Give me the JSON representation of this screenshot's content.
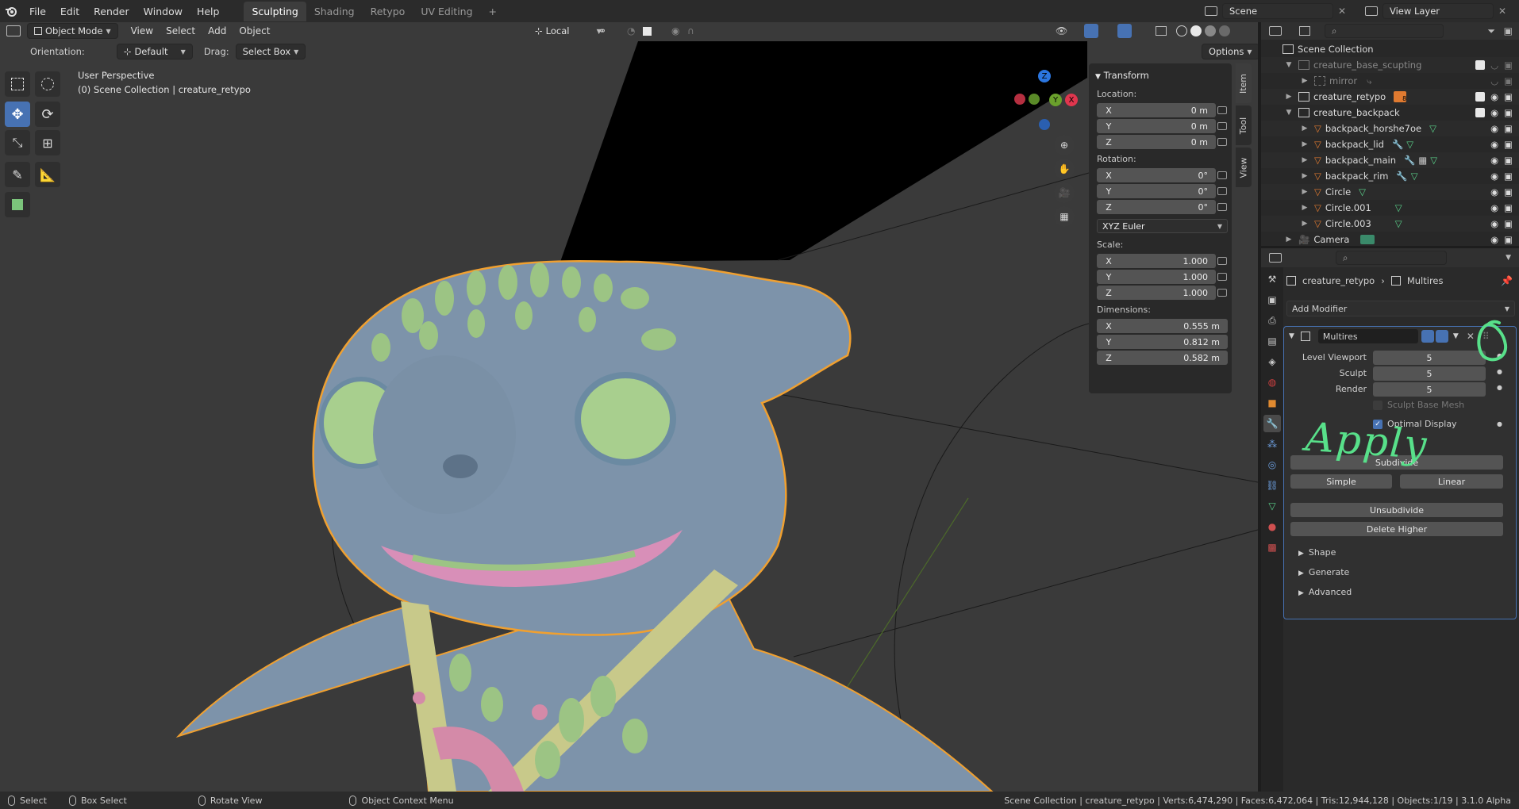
{
  "topbar": {
    "menus": [
      "File",
      "Edit",
      "Render",
      "Window",
      "Help"
    ],
    "workspaces": [
      "Sculpting",
      "Shading",
      "Retypo",
      "UV Editing"
    ],
    "active_workspace": "Sculpting",
    "add_tab": "+",
    "scene": "Scene",
    "view_layer": "View Layer"
  },
  "viewport": {
    "mode": "Object Mode",
    "menus": [
      "View",
      "Select",
      "Add",
      "Object"
    ],
    "transform_orientation": "Local",
    "orientation_label": "Orientation:",
    "orientation_value": "Default",
    "drag_label": "Drag:",
    "drag_value": "Select Box",
    "options": "Options",
    "perspective": "User Perspective",
    "collection_info": "(0) Scene Collection | creature_retypo",
    "gizmo": {
      "x": "X",
      "y": "Y",
      "z": "Z"
    }
  },
  "npanel": {
    "tabs": [
      "Item",
      "Tool",
      "View"
    ],
    "title": "Transform",
    "location_label": "Location:",
    "location": [
      {
        "axis": "X",
        "value": "0 m"
      },
      {
        "axis": "Y",
        "value": "0 m"
      },
      {
        "axis": "Z",
        "value": "0 m"
      }
    ],
    "rotation_label": "Rotation:",
    "rotation": [
      {
        "axis": "X",
        "value": "0°"
      },
      {
        "axis": "Y",
        "value": "0°"
      },
      {
        "axis": "Z",
        "value": "0°"
      }
    ],
    "rotation_mode": "XYZ Euler",
    "scale_label": "Scale:",
    "scale": [
      {
        "axis": "X",
        "value": "1.000"
      },
      {
        "axis": "Y",
        "value": "1.000"
      },
      {
        "axis": "Z",
        "value": "1.000"
      }
    ],
    "dimensions_label": "Dimensions:",
    "dimensions": [
      {
        "axis": "X",
        "value": "0.555 m"
      },
      {
        "axis": "Y",
        "value": "0.812 m"
      },
      {
        "axis": "Z",
        "value": "0.582 m"
      }
    ]
  },
  "outliner": {
    "rows": [
      {
        "name": "Scene Collection"
      },
      {
        "name": "creature_base_scupting"
      },
      {
        "name": "mirror"
      },
      {
        "name": "creature_retypo",
        "badge": "8"
      },
      {
        "name": "creature_backpack"
      },
      {
        "name": "backpack_horshe7oe"
      },
      {
        "name": "backpack_lid"
      },
      {
        "name": "backpack_main"
      },
      {
        "name": "backpack_rim"
      },
      {
        "name": "Circle"
      },
      {
        "name": "Circle.001"
      },
      {
        "name": "Circle.003"
      },
      {
        "name": "Camera"
      }
    ]
  },
  "properties": {
    "breadcrumb_object": "creature_retypo",
    "breadcrumb_sep": "›",
    "breadcrumb_modifier": "Multires",
    "add_modifier": "Add Modifier",
    "modifier_name": "Multires",
    "level_viewport_label": "Level Viewport",
    "level_viewport": "5",
    "sculpt_label": "Sculpt",
    "sculpt": "5",
    "render_label": "Render",
    "render": "5",
    "sculpt_base_mesh": "Sculpt Base Mesh",
    "optimal_display": "Optimal Display",
    "subdivide": "Subdivide",
    "simple": "Simple",
    "linear": "Linear",
    "unsubdivide": "Unsubdivide",
    "delete_higher": "Delete Higher",
    "sections": [
      "Shape",
      "Generate",
      "Advanced"
    ],
    "annotation": "Apply"
  },
  "statusbar": {
    "select": "Select",
    "box_select": "Box Select",
    "rotate_view": "Rotate View",
    "context_menu": "Object Context Menu",
    "stats": "Scene Collection | creature_retypo | Verts:6,474,290 | Faces:6,472,064 | Tris:12,944,128 | Objects:1/19 | 3.1.0 Alpha"
  },
  "colors": {
    "accent": "#4772b3",
    "selection_outline": "#f0a030",
    "creature_body": "#7d93aa",
    "creature_spikes": "#9cc484",
    "annotation": "#58e08a"
  }
}
